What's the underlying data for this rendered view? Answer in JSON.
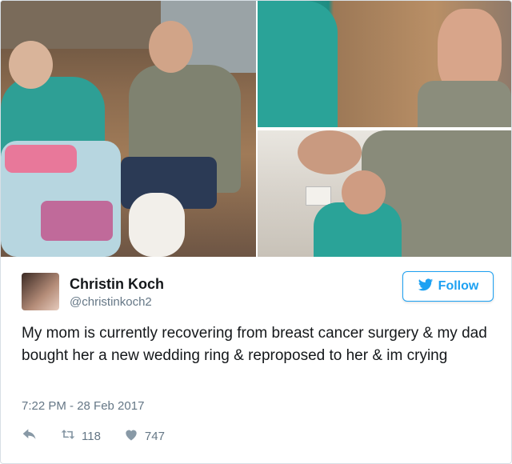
{
  "tweet": {
    "author_name": "Christin Koch",
    "author_handle": "@christinkoch2",
    "follow_label": "Follow",
    "text": "My mom is currently recovering from breast cancer surgery & my dad bought her a new wedding ring & reproposed to her & im crying",
    "timestamp": "7:22 PM - 28 Feb 2017",
    "retweets": "118",
    "likes": "747"
  },
  "icons": {
    "reply": "reply-icon",
    "retweet": "retweet-icon",
    "like": "heart-icon",
    "follow_bird": "twitter-bird-icon"
  },
  "colors": {
    "accent": "#1da1f2",
    "text": "#14171a",
    "muted": "#657786"
  }
}
